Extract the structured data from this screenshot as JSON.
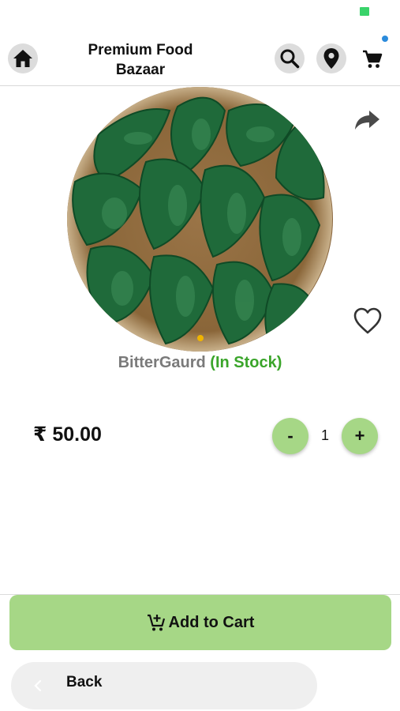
{
  "header": {
    "title_line1": "Premium Food",
    "title_line2": "Bazaar"
  },
  "product": {
    "name": "BitterGaurd",
    "stock_status": "(In Stock)",
    "price": "₹ 50.00",
    "quantity": "1",
    "image_icon": "bitter-gourd-basket-image"
  },
  "controls": {
    "minus_label": "-",
    "plus_label": "+",
    "add_to_cart_label": "Add to Cart",
    "back_label": "Back"
  },
  "icons": {
    "home": "home-icon",
    "search": "search-icon",
    "location": "location-pin-icon",
    "cart": "cart-icon",
    "share": "share-arrow-icon",
    "favorite": "heart-outline-icon",
    "add_to_cart": "cart-plus-icon",
    "back": "chevron-left-icon"
  },
  "colors": {
    "accent_green": "#a6d786",
    "stock_green": "#3aa52a",
    "notification_blue": "#2b8bdc",
    "carousel_dot": "#f0b400"
  }
}
